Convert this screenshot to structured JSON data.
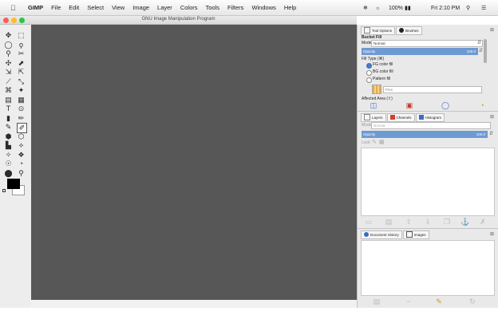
{
  "menubar": {
    "items": [
      "GIMP",
      "File",
      "Edit",
      "Select",
      "View",
      "Image",
      "Layer",
      "Colors",
      "Tools",
      "Filters",
      "Windows",
      "Help"
    ],
    "battery": "100%",
    "clock": "Fri 2:10 PM"
  },
  "window": {
    "title": "GNU Image Manipulation Program"
  },
  "toolbox": {
    "tool_glyphs": [
      "✥",
      "⬚",
      "◯",
      "ϙ",
      "⚲",
      "✂",
      "✣",
      "⬈",
      "⇲",
      "⇱",
      "⟋",
      "⤡",
      "⌘",
      "✦",
      "▤",
      "▦",
      "T",
      "⊙",
      "▮",
      "✏",
      "✎",
      "✐",
      "⬢",
      "⬡",
      "▙",
      "⟡",
      "✧",
      "❖",
      "☉",
      "◔",
      "⬤",
      "⚲"
    ],
    "colors": {
      "fg": "#000000",
      "bg": "#ffffff"
    }
  },
  "tool_options": {
    "tabs": [
      "Tool Options",
      "Brushes"
    ],
    "tool_name": "Bucket Fill",
    "mode_label": "Mode",
    "mode_value": "Normal",
    "opacity_label": "Opacity",
    "opacity_value": "100.0",
    "fill_type_label": "Fill Type (⌘)",
    "fill_options": [
      "FG color fill",
      "BG color fill",
      "Pattern fill"
    ],
    "selected_fill": 0,
    "pattern_name": "Pine",
    "affected_area_label": "Affected Area (⇧)"
  },
  "layers": {
    "tabs": [
      "Layers",
      "Channels",
      "Histogram"
    ],
    "mode_label": "Mode",
    "mode_value": "Normal",
    "opacity_label": "Opacity",
    "opacity_value": "100.0",
    "lock_label": "Lock:"
  },
  "history": {
    "tabs": [
      "Document History",
      "Images"
    ]
  },
  "colors": {
    "canvas": "#575757",
    "accent_blue": "#6e9ad2",
    "dock_bg": "#e9e9e9",
    "close_red": "#fc5f57",
    "min_yellow": "#fdbc2e",
    "max_green": "#28c840"
  }
}
